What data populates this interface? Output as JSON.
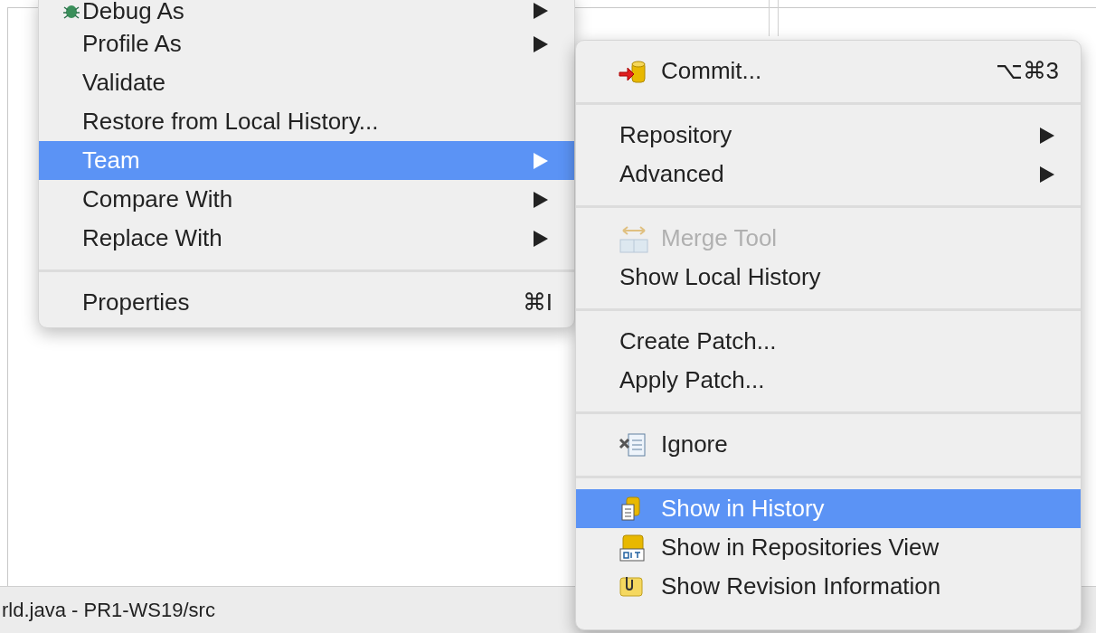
{
  "status_bar": {
    "text": "rld.java - PR1-WS19/src"
  },
  "context_menu": {
    "items": [
      {
        "kind": "item",
        "label": "Debug As",
        "selected": false,
        "has_submenu": true
      },
      {
        "kind": "item",
        "label": "Profile As",
        "selected": false,
        "has_submenu": true
      },
      {
        "kind": "item",
        "label": "Validate",
        "selected": false,
        "has_submenu": false
      },
      {
        "kind": "item",
        "label": "Restore from Local History...",
        "selected": false,
        "has_submenu": false
      },
      {
        "kind": "item",
        "label": "Team",
        "selected": true,
        "has_submenu": true
      },
      {
        "kind": "item",
        "label": "Compare With",
        "selected": false,
        "has_submenu": true
      },
      {
        "kind": "item",
        "label": "Replace With",
        "selected": false,
        "has_submenu": true
      },
      {
        "kind": "separator"
      },
      {
        "kind": "item",
        "label": "Properties",
        "selected": false,
        "has_submenu": false,
        "shortcut": "⌘I"
      }
    ]
  },
  "team_submenu": {
    "items": [
      {
        "kind": "item",
        "label": "Commit...",
        "selected": false,
        "has_submenu": false,
        "shortcut": "⌥⌘3"
      },
      {
        "kind": "separator"
      },
      {
        "kind": "item",
        "label": "Repository",
        "selected": false,
        "has_submenu": true
      },
      {
        "kind": "item",
        "label": "Advanced",
        "selected": false,
        "has_submenu": true
      },
      {
        "kind": "separator"
      },
      {
        "kind": "item",
        "label": "Merge Tool",
        "selected": false,
        "has_submenu": false,
        "disabled": true
      },
      {
        "kind": "item",
        "label": "Show Local History",
        "selected": false,
        "has_submenu": false
      },
      {
        "kind": "separator"
      },
      {
        "kind": "item",
        "label": "Create Patch...",
        "selected": false,
        "has_submenu": false
      },
      {
        "kind": "item",
        "label": "Apply Patch...",
        "selected": false,
        "has_submenu": false
      },
      {
        "kind": "separator"
      },
      {
        "kind": "item",
        "label": "Ignore",
        "selected": false,
        "has_submenu": false
      },
      {
        "kind": "separator"
      },
      {
        "kind": "item",
        "label": "Show in History",
        "selected": true,
        "has_submenu": false
      },
      {
        "kind": "item",
        "label": "Show in Repositories View",
        "selected": false,
        "has_submenu": false
      },
      {
        "kind": "item",
        "label": "Show Revision Information",
        "selected": false,
        "has_submenu": false
      }
    ]
  }
}
